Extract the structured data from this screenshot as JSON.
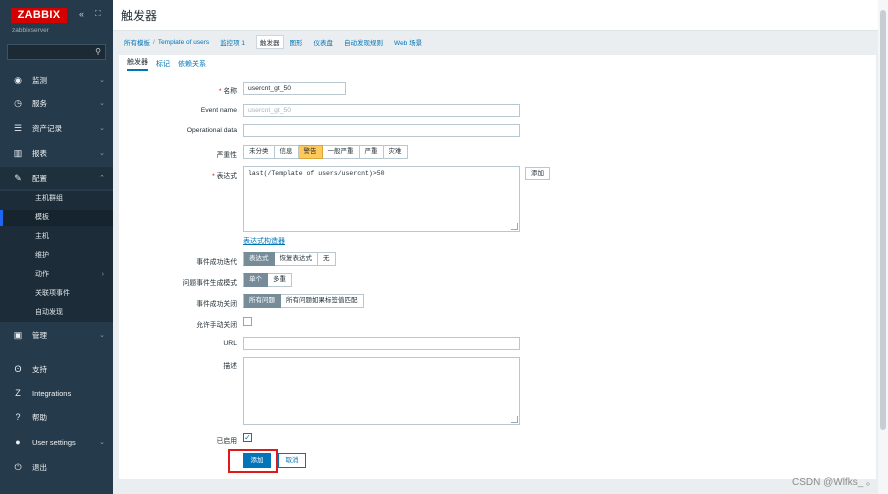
{
  "sidebar": {
    "logo": "ZABBIX",
    "collapse_icon": "«",
    "kiosk_icon": "⛶",
    "server_name": "zabbixserver",
    "search_placeholder": "",
    "menu": [
      {
        "icon": "eye-icon",
        "glyph": "◉",
        "label": "监测"
      },
      {
        "icon": "clock-icon",
        "glyph": "◷",
        "label": "服务"
      },
      {
        "icon": "list-icon",
        "glyph": "☰",
        "label": "资产记录"
      },
      {
        "icon": "bar-chart-icon",
        "glyph": "▥",
        "label": "报表"
      },
      {
        "icon": "wrench-icon",
        "glyph": "✎",
        "label": "配置"
      }
    ],
    "submenu": [
      "主机群组",
      "模板",
      "主机",
      "维护",
      "动作",
      "关联项事件",
      "自动发现"
    ],
    "menu_bottom": [
      {
        "icon": "admin-icon",
        "glyph": "▣",
        "label": "管理"
      },
      {
        "icon": "support-icon",
        "glyph": "ʘ",
        "label": "支持"
      },
      {
        "icon": "integrations-icon",
        "glyph": "Z",
        "label": "Integrations"
      },
      {
        "icon": "help-icon",
        "glyph": "?",
        "label": "帮助"
      },
      {
        "icon": "user-icon",
        "glyph": "●",
        "label": "User settings"
      },
      {
        "icon": "power-icon",
        "glyph": "⏻",
        "label": "退出"
      }
    ]
  },
  "header": {
    "title": "触发器"
  },
  "breadcrumbs": {
    "items": [
      "所有模板",
      "Template of users",
      "监控项 1",
      "触发器",
      "图形",
      "仪表盘",
      "自动发现规则",
      "Web 场景"
    ],
    "separator": "/"
  },
  "tabs": [
    "触发器",
    "标记",
    "依赖关系"
  ],
  "form": {
    "name_label": "名称",
    "name_value": "usercnt_gt_50",
    "event_name_label": "Event name",
    "event_name_placeholder": "usercnt_gt_50",
    "opdata_label": "Operational data",
    "opdata_value": "",
    "severity_label": "严重性",
    "severity_options": [
      "未分类",
      "信息",
      "警告",
      "一般严重",
      "严重",
      "灾难"
    ],
    "severity_selected": "警告",
    "expression_label": "表达式",
    "expression_value": "last(/Template of users/usercnt)>50",
    "add_expression_button": "添加",
    "expression_constructor_link": "表达式构造器",
    "ok_event_gen_label": "事件成功迭代",
    "ok_event_gen_options": [
      "表达式",
      "恢复表达式",
      "无"
    ],
    "ok_event_gen_selected": "表达式",
    "problem_mode_label": "问题事件生成模式",
    "problem_mode_options": [
      "单个",
      "多重"
    ],
    "problem_mode_selected": "单个",
    "ok_close_label": "事件成功关闭",
    "ok_close_options": [
      "所有问题",
      "所有问题如果标签值匹配"
    ],
    "ok_close_selected": "所有问题",
    "manual_close_label": "允许手动关闭",
    "manual_close_checked": false,
    "url_label": "URL",
    "url_value": "",
    "description_label": "描述",
    "description_value": "",
    "enabled_label": "已启用",
    "enabled_checked": true,
    "add_button": "添加",
    "cancel_button": "取消"
  },
  "watermark": "CSDN @Wlfks_ 。"
}
